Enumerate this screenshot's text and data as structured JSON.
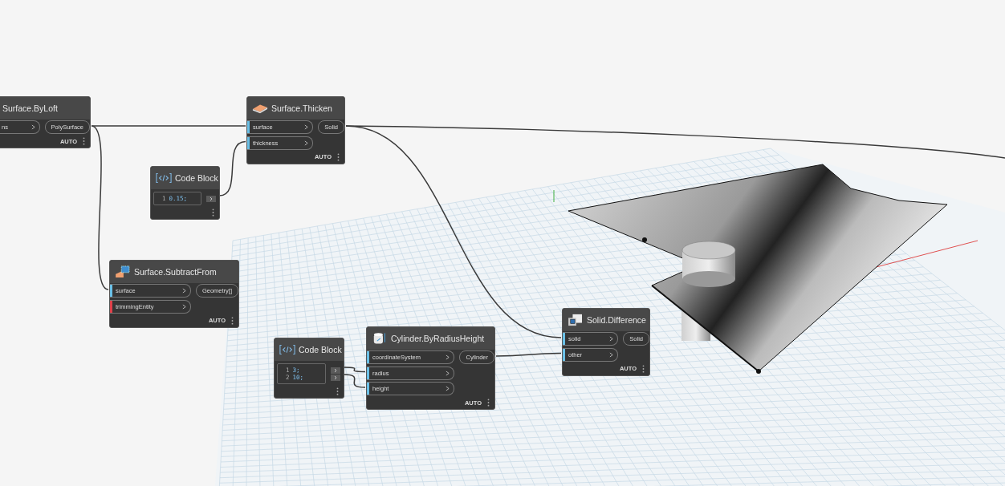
{
  "nodes": [
    {
      "title": "Surface.ByLoft",
      "kind": "function",
      "inputs": [
        {
          "label": "ns"
        }
      ],
      "outputs": [
        "PolySurface"
      ],
      "lacing": "AUTO"
    },
    {
      "title": "Surface.Thicken",
      "kind": "function",
      "inputs": [
        {
          "label": "surface",
          "error": false
        },
        {
          "label": "thickness",
          "error": false
        }
      ],
      "outputs": [
        "Solid"
      ],
      "lacing": "AUTO"
    },
    {
      "title": "Code Block",
      "kind": "code",
      "lines": [
        {
          "number": "1",
          "code": "0.15;"
        }
      ]
    },
    {
      "title": "Surface.SubtractFrom",
      "kind": "function",
      "inputs": [
        {
          "label": "surface",
          "error": false
        },
        {
          "label": "trimmingEntity",
          "error": true
        }
      ],
      "outputs": [
        "Geometry[]"
      ],
      "lacing": "AUTO"
    },
    {
      "title": "Code Block",
      "kind": "code",
      "lines": [
        {
          "number": "1",
          "code": "3;"
        },
        {
          "number": "2",
          "code": "10;"
        }
      ]
    },
    {
      "title": "Cylinder.ByRadiusHeight",
      "kind": "function",
      "inputs": [
        {
          "label": "coordinateSystem",
          "error": false
        },
        {
          "label": "radius",
          "error": false
        },
        {
          "label": "height",
          "error": false
        }
      ],
      "outputs": [
        "Cylinder"
      ],
      "lacing": "AUTO"
    },
    {
      "title": "Solid.Difference",
      "kind": "function",
      "inputs": [
        {
          "label": "solid",
          "error": false
        },
        {
          "label": "other",
          "error": false
        }
      ],
      "outputs": [
        "Solid"
      ],
      "lacing": "AUTO"
    }
  ]
}
